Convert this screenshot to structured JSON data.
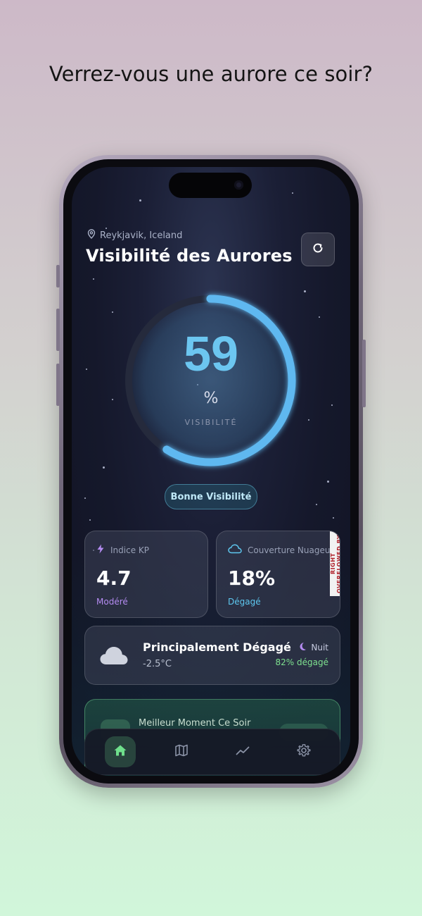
{
  "headline": "Verrez-vous une aurore ce soir?",
  "header": {
    "location": "Reykjavik, Iceland",
    "title": "Visibilité des Aurores"
  },
  "gauge": {
    "value": "59",
    "percent": 0.59,
    "unit": "%",
    "label": "VISIBILITÉ",
    "status": "Bonne Visibilité"
  },
  "cards": {
    "kp": {
      "label": "Indice KP",
      "value": "4.7",
      "status": "Modéré"
    },
    "cloud": {
      "label": "Couverture Nuageuse",
      "value": "18%",
      "status": "Dégagé",
      "overflow_label": "RIGHT OVERFLOWED BY"
    }
  },
  "weather": {
    "title": "Principalement Dégagé",
    "temp": "-2.5°C",
    "night_label": "Nuit",
    "clear_percent": "82% dégagé"
  },
  "best_time": {
    "title": "Meilleur Moment Ce Soir"
  },
  "nav": {
    "items": [
      "home-icon",
      "map-icon",
      "trend-icon",
      "gear-icon"
    ],
    "active": "home-icon"
  },
  "colors": {
    "gauge_arc": "#5fb8f0",
    "gauge_track": "#252a3c",
    "kp_accent": "#b58cf2",
    "cloud_accent": "#5ec8f0",
    "clear_green": "#7ee08f"
  }
}
